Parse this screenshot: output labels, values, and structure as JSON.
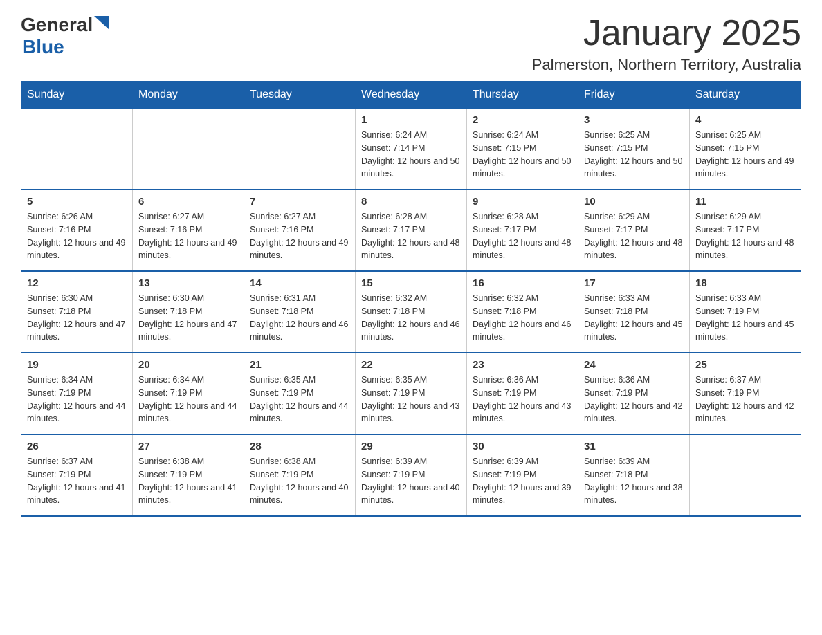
{
  "logo": {
    "general": "General",
    "blue": "Blue"
  },
  "header": {
    "title": "January 2025",
    "location": "Palmerston, Northern Territory, Australia"
  },
  "weekdays": [
    "Sunday",
    "Monday",
    "Tuesday",
    "Wednesday",
    "Thursday",
    "Friday",
    "Saturday"
  ],
  "weeks": [
    [
      {
        "day": "",
        "info": ""
      },
      {
        "day": "",
        "info": ""
      },
      {
        "day": "",
        "info": ""
      },
      {
        "day": "1",
        "info": "Sunrise: 6:24 AM\nSunset: 7:14 PM\nDaylight: 12 hours and 50 minutes."
      },
      {
        "day": "2",
        "info": "Sunrise: 6:24 AM\nSunset: 7:15 PM\nDaylight: 12 hours and 50 minutes."
      },
      {
        "day": "3",
        "info": "Sunrise: 6:25 AM\nSunset: 7:15 PM\nDaylight: 12 hours and 50 minutes."
      },
      {
        "day": "4",
        "info": "Sunrise: 6:25 AM\nSunset: 7:15 PM\nDaylight: 12 hours and 49 minutes."
      }
    ],
    [
      {
        "day": "5",
        "info": "Sunrise: 6:26 AM\nSunset: 7:16 PM\nDaylight: 12 hours and 49 minutes."
      },
      {
        "day": "6",
        "info": "Sunrise: 6:27 AM\nSunset: 7:16 PM\nDaylight: 12 hours and 49 minutes."
      },
      {
        "day": "7",
        "info": "Sunrise: 6:27 AM\nSunset: 7:16 PM\nDaylight: 12 hours and 49 minutes."
      },
      {
        "day": "8",
        "info": "Sunrise: 6:28 AM\nSunset: 7:17 PM\nDaylight: 12 hours and 48 minutes."
      },
      {
        "day": "9",
        "info": "Sunrise: 6:28 AM\nSunset: 7:17 PM\nDaylight: 12 hours and 48 minutes."
      },
      {
        "day": "10",
        "info": "Sunrise: 6:29 AM\nSunset: 7:17 PM\nDaylight: 12 hours and 48 minutes."
      },
      {
        "day": "11",
        "info": "Sunrise: 6:29 AM\nSunset: 7:17 PM\nDaylight: 12 hours and 48 minutes."
      }
    ],
    [
      {
        "day": "12",
        "info": "Sunrise: 6:30 AM\nSunset: 7:18 PM\nDaylight: 12 hours and 47 minutes."
      },
      {
        "day": "13",
        "info": "Sunrise: 6:30 AM\nSunset: 7:18 PM\nDaylight: 12 hours and 47 minutes."
      },
      {
        "day": "14",
        "info": "Sunrise: 6:31 AM\nSunset: 7:18 PM\nDaylight: 12 hours and 46 minutes."
      },
      {
        "day": "15",
        "info": "Sunrise: 6:32 AM\nSunset: 7:18 PM\nDaylight: 12 hours and 46 minutes."
      },
      {
        "day": "16",
        "info": "Sunrise: 6:32 AM\nSunset: 7:18 PM\nDaylight: 12 hours and 46 minutes."
      },
      {
        "day": "17",
        "info": "Sunrise: 6:33 AM\nSunset: 7:18 PM\nDaylight: 12 hours and 45 minutes."
      },
      {
        "day": "18",
        "info": "Sunrise: 6:33 AM\nSunset: 7:19 PM\nDaylight: 12 hours and 45 minutes."
      }
    ],
    [
      {
        "day": "19",
        "info": "Sunrise: 6:34 AM\nSunset: 7:19 PM\nDaylight: 12 hours and 44 minutes."
      },
      {
        "day": "20",
        "info": "Sunrise: 6:34 AM\nSunset: 7:19 PM\nDaylight: 12 hours and 44 minutes."
      },
      {
        "day": "21",
        "info": "Sunrise: 6:35 AM\nSunset: 7:19 PM\nDaylight: 12 hours and 44 minutes."
      },
      {
        "day": "22",
        "info": "Sunrise: 6:35 AM\nSunset: 7:19 PM\nDaylight: 12 hours and 43 minutes."
      },
      {
        "day": "23",
        "info": "Sunrise: 6:36 AM\nSunset: 7:19 PM\nDaylight: 12 hours and 43 minutes."
      },
      {
        "day": "24",
        "info": "Sunrise: 6:36 AM\nSunset: 7:19 PM\nDaylight: 12 hours and 42 minutes."
      },
      {
        "day": "25",
        "info": "Sunrise: 6:37 AM\nSunset: 7:19 PM\nDaylight: 12 hours and 42 minutes."
      }
    ],
    [
      {
        "day": "26",
        "info": "Sunrise: 6:37 AM\nSunset: 7:19 PM\nDaylight: 12 hours and 41 minutes."
      },
      {
        "day": "27",
        "info": "Sunrise: 6:38 AM\nSunset: 7:19 PM\nDaylight: 12 hours and 41 minutes."
      },
      {
        "day": "28",
        "info": "Sunrise: 6:38 AM\nSunset: 7:19 PM\nDaylight: 12 hours and 40 minutes."
      },
      {
        "day": "29",
        "info": "Sunrise: 6:39 AM\nSunset: 7:19 PM\nDaylight: 12 hours and 40 minutes."
      },
      {
        "day": "30",
        "info": "Sunrise: 6:39 AM\nSunset: 7:19 PM\nDaylight: 12 hours and 39 minutes."
      },
      {
        "day": "31",
        "info": "Sunrise: 6:39 AM\nSunset: 7:18 PM\nDaylight: 12 hours and 38 minutes."
      },
      {
        "day": "",
        "info": ""
      }
    ]
  ]
}
